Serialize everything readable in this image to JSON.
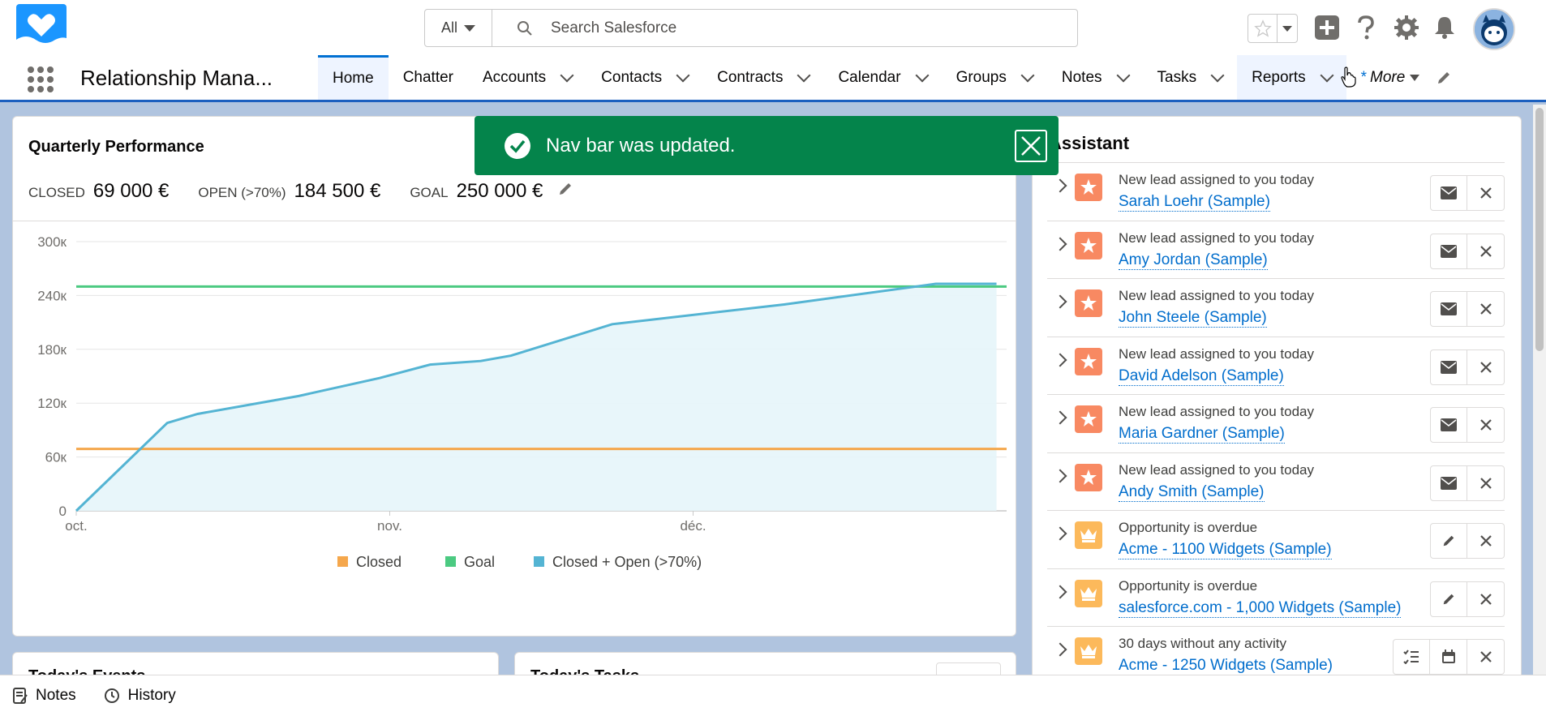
{
  "header": {
    "search_scope": "All",
    "search_placeholder": "Search Salesforce"
  },
  "nav": {
    "app_name": "Relationship Mana...",
    "tabs": [
      {
        "label": "Home"
      },
      {
        "label": "Chatter"
      },
      {
        "label": "Accounts"
      },
      {
        "label": "Contacts"
      },
      {
        "label": "Contracts"
      },
      {
        "label": "Calendar"
      },
      {
        "label": "Groups"
      },
      {
        "label": "Notes"
      },
      {
        "label": "Tasks"
      },
      {
        "label": "Reports"
      }
    ],
    "more_prefix": "*",
    "more_label": "More"
  },
  "toast": {
    "message": "Nav bar was updated."
  },
  "quarterly": {
    "title": "Quarterly Performance",
    "closed_label": "CLOSED",
    "closed_value": "69 000 €",
    "open_label": "OPEN (>70%)",
    "open_value": "184 500 €",
    "goal_label": "GOAL",
    "goal_value": "250 000 €"
  },
  "chart_data": {
    "type": "area",
    "x_tick_labels": [
      "oct.",
      "nov.",
      "déc."
    ],
    "y_tick_labels": [
      "0",
      "60к",
      "120к",
      "180к",
      "240к",
      "300к"
    ],
    "ylim": [
      0,
      300000
    ],
    "legend": [
      "Closed",
      "Goal",
      "Closed + Open (>70%)"
    ],
    "legend_position": "bottom",
    "colors": {
      "closed": "#f5a74c",
      "goal": "#4bca81",
      "closed_open": "#54b4d3"
    },
    "series": [
      {
        "name": "Closed",
        "values": [
          [
            0,
            69000
          ],
          [
            92,
            69000
          ]
        ]
      },
      {
        "name": "Goal",
        "values": [
          [
            0,
            250000
          ],
          [
            92,
            250000
          ]
        ]
      },
      {
        "name": "Closed + Open (>70%)",
        "values": [
          [
            0,
            0
          ],
          [
            9,
            98000
          ],
          [
            12,
            108000
          ],
          [
            22,
            128000
          ],
          [
            30,
            148000
          ],
          [
            35,
            163000
          ],
          [
            40,
            167000
          ],
          [
            43,
            173000
          ],
          [
            53,
            208000
          ],
          [
            70,
            230000
          ],
          [
            85,
            253000
          ],
          [
            91,
            253000
          ]
        ]
      }
    ],
    "x_range_days": [
      0,
      92
    ],
    "x_tick_days": [
      0,
      31,
      61
    ],
    "grid": true
  },
  "assistant": {
    "title": "Assistant",
    "items": [
      {
        "kind": "lead",
        "text": "New lead assigned to you today",
        "link": "Sarah Loehr (Sample)",
        "actions": [
          "mail",
          "close"
        ]
      },
      {
        "kind": "lead",
        "text": "New lead assigned to you today",
        "link": "Amy Jordan (Sample)",
        "actions": [
          "mail",
          "close"
        ]
      },
      {
        "kind": "lead",
        "text": "New lead assigned to you today",
        "link": "John Steele (Sample)",
        "actions": [
          "mail",
          "close"
        ]
      },
      {
        "kind": "lead",
        "text": "New lead assigned to you today",
        "link": "David Adelson (Sample)",
        "actions": [
          "mail",
          "close"
        ]
      },
      {
        "kind": "lead",
        "text": "New lead assigned to you today",
        "link": "Maria Gardner (Sample)",
        "actions": [
          "mail",
          "close"
        ]
      },
      {
        "kind": "lead",
        "text": "New lead assigned to you today",
        "link": "Andy Smith (Sample)",
        "actions": [
          "mail",
          "close"
        ]
      },
      {
        "kind": "opp",
        "text": "Opportunity is overdue",
        "link": "Acme - 1100 Widgets (Sample)",
        "actions": [
          "edit",
          "close"
        ]
      },
      {
        "kind": "opp",
        "text": "Opportunity is overdue",
        "link": "salesforce.com - 1,000 Widgets (Sample)",
        "actions": [
          "edit",
          "close"
        ]
      },
      {
        "kind": "opp",
        "text": "30 days without any activity",
        "link": "Acme - 1250 Widgets (Sample)",
        "actions": [
          "task",
          "event",
          "close"
        ]
      }
    ]
  },
  "events": {
    "title": "Today's Events"
  },
  "tasks": {
    "title": "Today's Tasks"
  },
  "footer": {
    "notes_label": "Notes",
    "history_label": "History"
  }
}
